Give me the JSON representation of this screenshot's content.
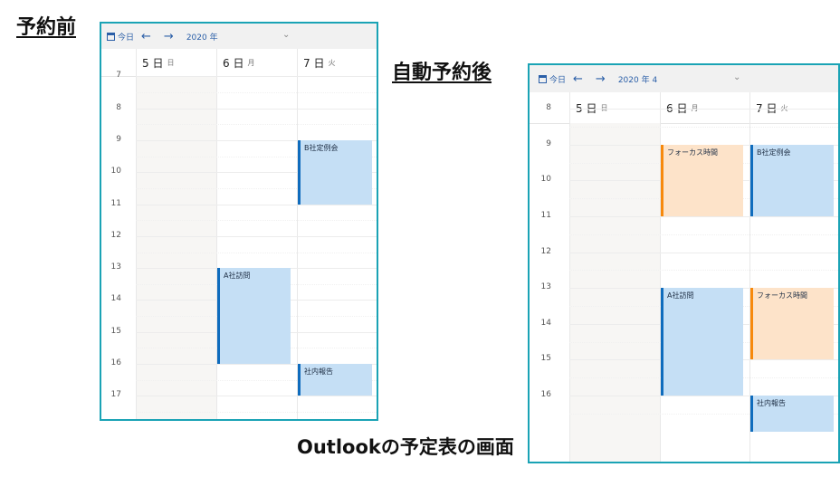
{
  "headings": {
    "before": "予約前",
    "after": "自動予約後",
    "caption": "Outlookの予定表の画面"
  },
  "before_panel": {
    "toolbar": {
      "today": "今日",
      "month": "2020 年"
    },
    "days": [
      {
        "num": "5 日",
        "dow": "日"
      },
      {
        "num": "6 日",
        "dow": "月"
      },
      {
        "num": "7 日",
        "dow": "火"
      }
    ],
    "hours": [
      "7",
      "8",
      "9",
      "10",
      "11",
      "12",
      "13",
      "14",
      "15",
      "16",
      "17"
    ],
    "events": [
      {
        "title": "B社定例会",
        "day": 2,
        "start": 9.0,
        "end": 11.0,
        "color": "blue"
      },
      {
        "title": "A社訪問",
        "day": 1,
        "start": 13.0,
        "end": 16.0,
        "color": "blue"
      },
      {
        "title": "社内報告",
        "day": 2,
        "start": 16.0,
        "end": 17.0,
        "color": "blue"
      }
    ]
  },
  "after_panel": {
    "toolbar": {
      "today": "今日",
      "month": "2020 年 4"
    },
    "days": [
      {
        "num": "5 日",
        "dow": "日"
      },
      {
        "num": "6 日",
        "dow": "月"
      },
      {
        "num": "7 日",
        "dow": "火"
      }
    ],
    "hours": [
      "8",
      "9",
      "10",
      "11",
      "12",
      "13",
      "14",
      "15",
      "16"
    ],
    "events": [
      {
        "title": "フォーカス時間",
        "day": 1,
        "start": 9.0,
        "end": 11.0,
        "color": "orange"
      },
      {
        "title": "B社定例会",
        "day": 2,
        "start": 9.0,
        "end": 11.0,
        "color": "blue"
      },
      {
        "title": "A社訪問",
        "day": 1,
        "start": 13.0,
        "end": 16.0,
        "color": "blue"
      },
      {
        "title": "フォーカス時間",
        "day": 2,
        "start": 13.0,
        "end": 15.0,
        "color": "orange"
      },
      {
        "title": "社内報告",
        "day": 2,
        "start": 16.0,
        "end": 17.0,
        "color": "blue"
      }
    ]
  },
  "colors": {
    "accent_blue": "#0f6cbd",
    "event_blue": "#c5dff5",
    "accent_orange": "#f7890c",
    "event_orange": "#fde3c9",
    "border": "#1aa3b5"
  }
}
